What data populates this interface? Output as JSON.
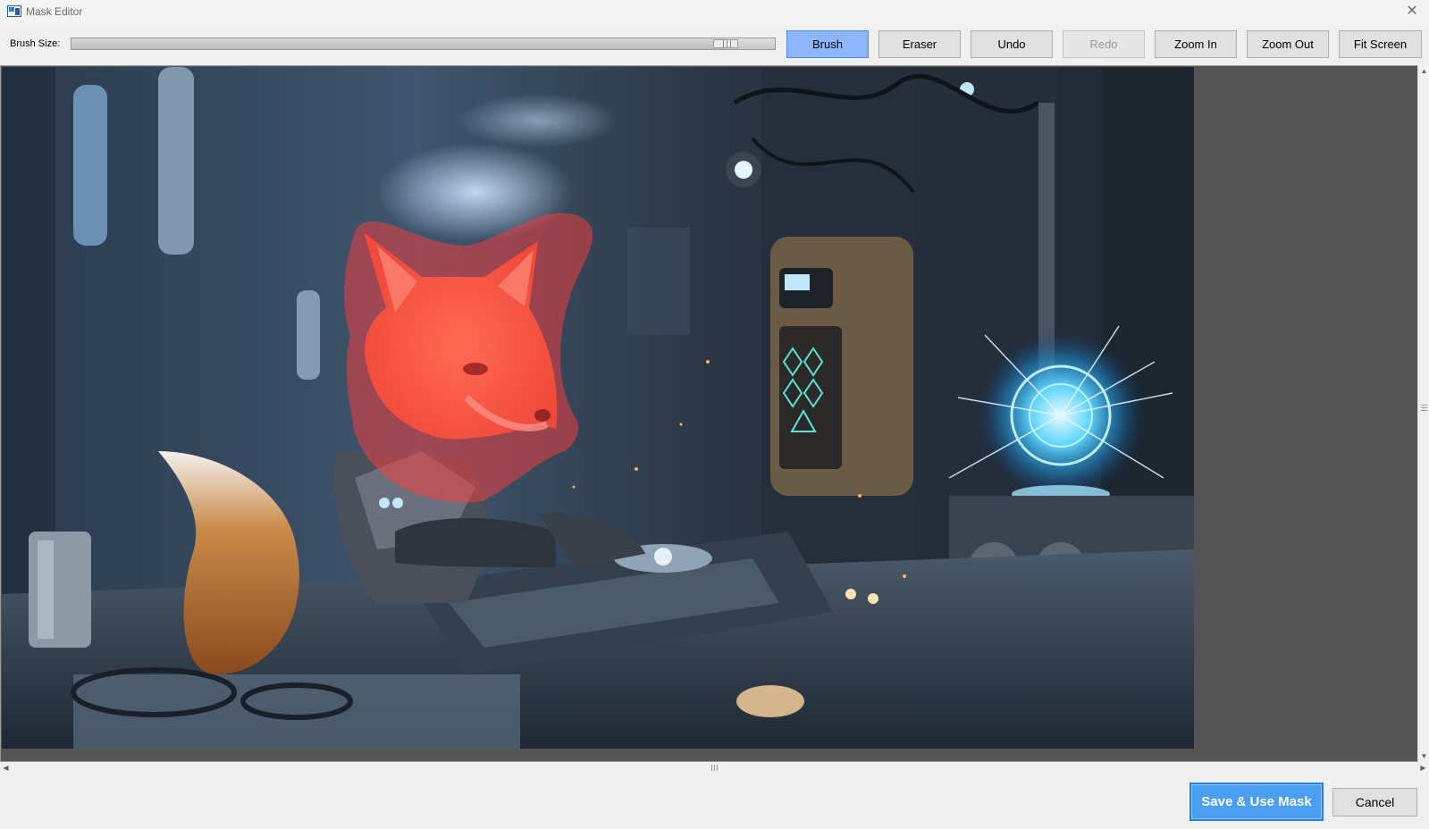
{
  "window": {
    "title": "Mask Editor"
  },
  "toolbar": {
    "brush_size_label": "Brush Size:",
    "brush_size_value": 0.93,
    "buttons": {
      "brush": "Brush",
      "eraser": "Eraser",
      "undo": "Undo",
      "redo": "Redo",
      "zoom_in": "Zoom In",
      "zoom_out": "Zoom Out",
      "fit_screen": "Fit Screen"
    },
    "active_tool": "brush"
  },
  "canvas": {
    "image_description_icon": "image",
    "mask_color": "#ff3c3c"
  },
  "footer": {
    "save_label": "Save & Use Mask",
    "cancel_label": "Cancel"
  },
  "colors": {
    "accent": "#4a9ff5",
    "active_tool_bg": "#8cb7ff",
    "canvas_bg": "#555555"
  }
}
